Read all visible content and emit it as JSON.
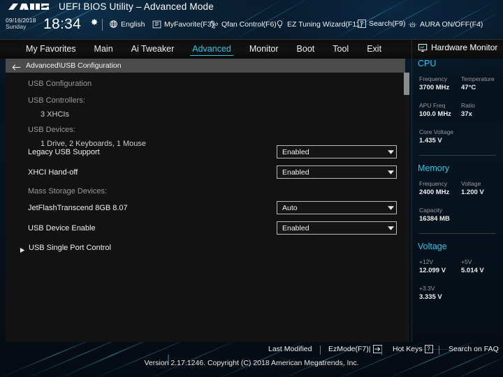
{
  "window": {
    "logo": "asus-logo",
    "title": "UEFI BIOS Utility – Advanced Mode"
  },
  "toolstrip": {
    "date": "09/16/2018",
    "weekday": "Sunday",
    "time": "18:34",
    "gear_icon": "gear-icon",
    "tools": [
      {
        "label": "English",
        "icon": "globe-icon"
      },
      {
        "label": "MyFavorite(F3)",
        "icon": "star-list-icon"
      },
      {
        "label": "Qfan Control(F6)",
        "icon": "fan-icon"
      },
      {
        "label": "EZ Tuning Wizard(F11)",
        "icon": "lightbulb-icon"
      },
      {
        "label": "Search(F9)",
        "icon": "question-key-icon",
        "key": "?"
      },
      {
        "label": "AURA ON/OFF(F4)",
        "icon": "aura-light-icon"
      }
    ]
  },
  "tabs": [
    {
      "label": "My Favorites",
      "active": false
    },
    {
      "label": "Main",
      "active": false
    },
    {
      "label": "Ai Tweaker",
      "active": false
    },
    {
      "label": "Advanced",
      "active": true
    },
    {
      "label": "Monitor",
      "active": false
    },
    {
      "label": "Boot",
      "active": false
    },
    {
      "label": "Tool",
      "active": false
    },
    {
      "label": "Exit",
      "active": false
    }
  ],
  "breadcrumb": {
    "back_icon": "back-arrow-icon",
    "path": "Advanced\\USB Configuration"
  },
  "content": {
    "info_icon": "info-circle-icon",
    "headings": [
      {
        "text": "USB Configuration",
        "style": "dim"
      },
      {
        "text": "USB Controllers:",
        "style": "dim"
      },
      {
        "text": "3 XHCIs",
        "style": "indent"
      },
      {
        "text": "USB Devices:",
        "style": "dim"
      },
      {
        "text": "1 Drive, 2 Keyboards, 1 Mouse",
        "style": "indent"
      }
    ],
    "settings": [
      {
        "label": "Legacy USB Support",
        "value": "Enabled"
      },
      {
        "label": "XHCI Hand-off",
        "value": "Enabled"
      }
    ],
    "mass_storage_label": "Mass Storage Devices:",
    "storage_settings": [
      {
        "label": "JetFlashTranscend 8GB 8.07",
        "value": "Auto"
      },
      {
        "label": "USB Device Enable",
        "value": "Enabled"
      }
    ],
    "submenu": {
      "label": "USB Single Port Control",
      "icon": "right-arrow-icon"
    }
  },
  "hardware_monitor": {
    "title": "Hardware Monitor",
    "icon": "monitor-icon",
    "sections": [
      {
        "name": "CPU",
        "rows": [
          [
            {
              "key": "Frequency",
              "value": "3700 MHz"
            },
            {
              "key": "Temperature",
              "value": "47°C"
            }
          ],
          [
            {
              "key": "APU Freq",
              "value": "100.0 MHz"
            },
            {
              "key": "Ratio",
              "value": "37x"
            }
          ],
          [
            {
              "key": "Core Voltage",
              "value": "1.435 V"
            }
          ]
        ]
      },
      {
        "name": "Memory",
        "rows": [
          [
            {
              "key": "Frequency",
              "value": "2400 MHz"
            },
            {
              "key": "Voltage",
              "value": "1.200 V"
            }
          ],
          [
            {
              "key": "Capacity",
              "value": "16384 MB"
            }
          ]
        ]
      },
      {
        "name": "Voltage",
        "rows": [
          [
            {
              "key": "+12V",
              "value": "12.099 V"
            },
            {
              "key": "+5V",
              "value": "5.014 V"
            }
          ],
          [
            {
              "key": "+3.3V",
              "value": "3.335 V"
            }
          ]
        ]
      }
    ]
  },
  "footer": {
    "links": [
      {
        "label": "Last Modified"
      },
      {
        "label": "EzMode(F7)|",
        "icon": "exit-arrow-icon"
      },
      {
        "label": "Hot Keys",
        "icon": "question-key-icon",
        "key": "?"
      },
      {
        "label": "Search on FAQ"
      }
    ],
    "version": "Version 2.17.1246. Copyright (C) 2018 American Megatrends, Inc."
  },
  "colors": {
    "accent": "#2ec6e6",
    "panel": "#121212",
    "crumb_bar": "#4b4b4b"
  }
}
